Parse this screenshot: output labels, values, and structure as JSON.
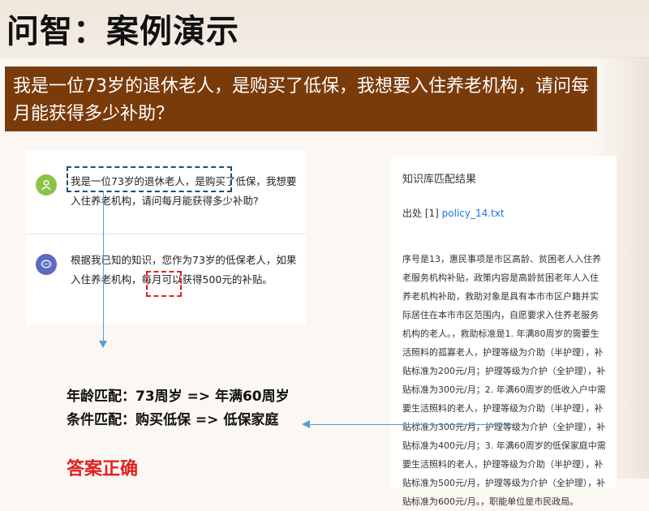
{
  "title": "问智：案例演示",
  "question_banner": "我是一位73岁的退休老人，是购买了低保，我想要入住养老机构，请问每月能获得多少补助？",
  "chat": {
    "user_message": "我是一位73岁的退休老人，是购买了低保，我想要入住养老机构，请问每月能获得多少补助?",
    "bot_message": "根据我已知的知识，您作为73岁的低保老人，如果入住养老机构，每月可以获得500元的补贴。",
    "bot_icon": "chat-bubble-icon",
    "user_icon": "user-icon"
  },
  "knowledge_base": {
    "title": "知识库匹配结果",
    "source_prefix": "出处 [1]",
    "source_file": "policy_14.txt",
    "body": "序号是13，惠民事项是市区高龄、贫困老人入住养老服务机构补贴，政策内容是高龄贫困老年人入住养老机构补助，救助对象是具有本市市区户籍并实际居住在本市市区范围内，自愿要求入住养老服务机构的老人。，救助标准是1. 年满80周岁的需要生活照料的孤寡老人，护理等级为介助（半护理），补贴标准为200元/月；护理等级为介护（全护理），补贴标准为300元/月；2. 年满60周岁的低收入户中需要生活照料的老人，护理等级为介助（半护理），补贴标准为300元/月，护理等级为介护（全护理），补贴标准为400元/月；3. 年满60周岁的低保家庭中需要生活照料的老人，护理等级为介助（半护理），补贴标准为500元/月，护理等级为介护（全护理），补贴标准为600元/月。，职能单位是市民政局。"
  },
  "matches": {
    "age": "年龄匹配：73周岁 => 年满60周岁",
    "condition": "条件匹配：购买低保 => 低保家庭"
  },
  "answer": "答案正确",
  "colors": {
    "banner": "#7a3b0b",
    "answer": "#e02020",
    "arrow": "#5b9bd5"
  }
}
